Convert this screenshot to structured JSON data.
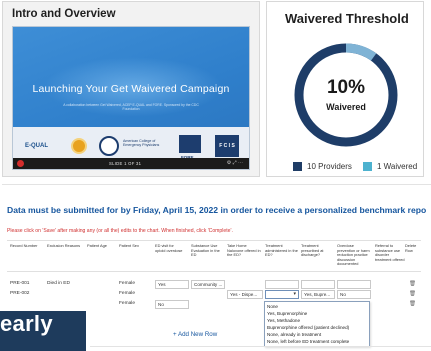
{
  "intro": {
    "title": "Intro and Overview",
    "video_title": "Launching Your Get Waivered Campaign",
    "video_subtitle": "A collaboration between Get Waivered, ACEP E-QUAL and FORE. Sponsored by the CDC Foundation",
    "logos": {
      "equal": "E-QUAL",
      "acep": "American College of Emergency Physicians",
      "fore": "FORE",
      "last": "F C I S"
    },
    "slide_label": "SLIDE 1 OF 31",
    "player_icons": "⚙ ⤢ ⋯"
  },
  "waivered": {
    "title": "Waivered Threshold",
    "percent_text": "10%",
    "percent_value": 10,
    "label": "Waivered",
    "legend": [
      {
        "text": "10 Providers",
        "color": "#1f3d66"
      },
      {
        "text": "1 Waivered",
        "color": "#4db2cf"
      }
    ],
    "ring_bg": "#1e3d68",
    "ring_fg": "#7fb3d5"
  },
  "headline": "Data must be submitted for by Friday, April 15, 2022 in order to receive a personalized benchmark repo",
  "instruction": "Please click on 'Save' after making any (or all the) edits to the chart. When finished, click 'Complete'.",
  "table": {
    "headers": {
      "record": "Record Number",
      "exclusion": "Exclusion Reasons",
      "age": "Patient Age",
      "sex": "Patient Sex",
      "ed_visit": "ED visit for opioid overdose",
      "sud": "Substance Use Evaluation in the ED",
      "take_home": "Take Home Naloxone offered in the ED?",
      "treatment_admin": "Treatment administered in the ED?",
      "treatment_discharge": "Treatment prescribed at discharge?",
      "overdose": "Overdose prevention or harm reduction practice discussion documented",
      "referral": "Referral to substance use disorder treatment offered",
      "delete": "Delete Row"
    },
    "rows": [
      {
        "record": "PRE-001",
        "exclusion": "Died in ED",
        "sex": "Female",
        "ed_visit": "Yes",
        "sud": "Community ...",
        "treatment_admin": "",
        "treatment_discharge": "",
        "overdose": ""
      },
      {
        "record": "PRE-002",
        "exclusion": "",
        "sex": "Female",
        "ed_visit": "",
        "sud": "",
        "take_home": "Yes - Dispe...",
        "treatment_admin": "",
        "treatment_discharge": "Yes, Bupre...",
        "overdose": "No"
      },
      {
        "record": "",
        "exclusion": "",
        "sex": "Female",
        "ed_visit": "No",
        "sud": "",
        "take_home": "",
        "treatment_admin": "",
        "treatment_discharge": "",
        "overdose": ""
      }
    ],
    "dropdown_options": [
      "None",
      "Yes, Buprenorphine",
      "Yes, Methadone",
      "Buprenorphine offered (patient declined)",
      "None, already in treatment",
      "None, left before ED treatment complete"
    ],
    "dropdown_selected": 0,
    "add_row_label": "+ Add New Row"
  },
  "banner": {
    "text": "early"
  }
}
